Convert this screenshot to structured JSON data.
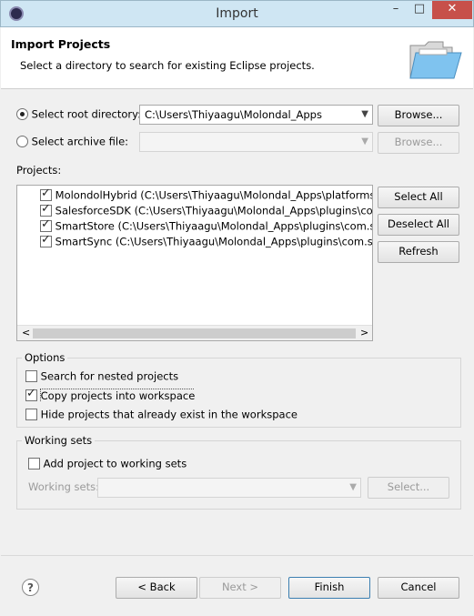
{
  "window": {
    "title": "Import",
    "minimize": "–",
    "maximize": "□",
    "close": "✕"
  },
  "header": {
    "title": "Import Projects",
    "subtitle": "Select a directory to search for existing Eclipse projects."
  },
  "root_dir": {
    "label": "Select root directory:",
    "value": "C:\\Users\\Thiyaagu\\Molondal_Apps",
    "browse": "Browse..."
  },
  "archive": {
    "label": "Select archive file:",
    "value": "",
    "browse": "Browse..."
  },
  "projects": {
    "label": "Projects:",
    "items": [
      "MolondolHybrid (C:\\Users\\Thiyaagu\\Molondal_Apps\\platforms\\a",
      "SalesforceSDK (C:\\Users\\Thiyaagu\\Molondal_Apps\\plugins\\com.s",
      "SmartStore (C:\\Users\\Thiyaagu\\Molondal_Apps\\plugins\\com.sale",
      "SmartSync (C:\\Users\\Thiyaagu\\Molondal_Apps\\plugins\\com.sale"
    ],
    "select_all": "Select All",
    "deselect_all": "Deselect All",
    "refresh": "Refresh"
  },
  "options": {
    "title": "Options",
    "nested": "Search for nested projects",
    "copy": "Copy projects into workspace",
    "hide": "Hide projects that already exist in the workspace"
  },
  "working_sets": {
    "title": "Working sets",
    "add": "Add project to working sets",
    "label": "Working sets:",
    "select": "Select..."
  },
  "footer": {
    "help": "?",
    "back": "< Back",
    "next": "Next >",
    "finish": "Finish",
    "cancel": "Cancel"
  }
}
